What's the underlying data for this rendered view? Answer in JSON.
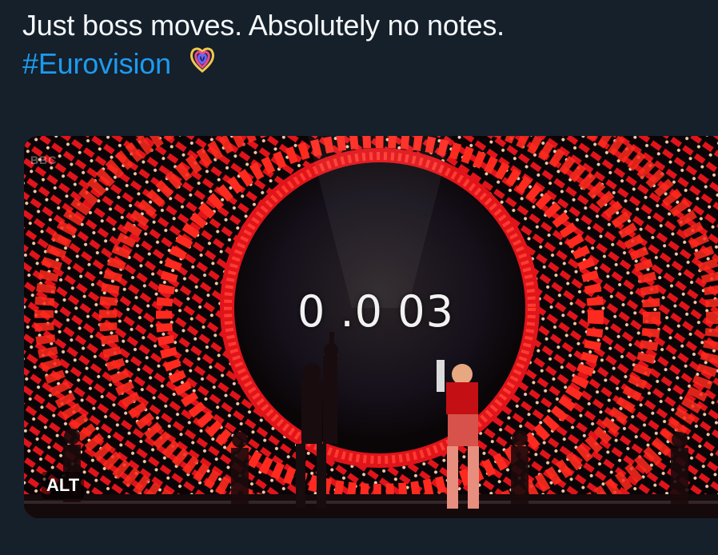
{
  "post": {
    "text_line1": "Just boss moves. Absolutely no notes.",
    "hashtag": "#Eurovision",
    "hashflag_icon": "eurovision-heart-hashflag"
  },
  "media": {
    "timer_text": "0 .0 03",
    "alt_badge": "ALT",
    "broadcaster_logo": "BBC"
  },
  "colors": {
    "background": "#15202b",
    "text": "#f5f8fa",
    "link": "#1d9bf0",
    "stage_red": "#e0141a"
  }
}
